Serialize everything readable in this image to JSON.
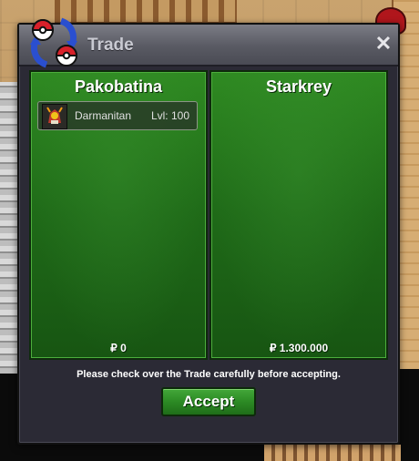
{
  "window": {
    "title": "Trade",
    "close_label": "✕"
  },
  "left_panel": {
    "player_name": "Pakobatina",
    "items": [
      {
        "pokemon": "Darmanitan",
        "level": "Lvl: 100"
      }
    ],
    "money": "₽ 0"
  },
  "right_panel": {
    "player_name": "Starkrey",
    "items": [],
    "money": "₽ 1.300.000"
  },
  "notice": "Please check over the Trade carefully before accepting.",
  "accept_label": "Accept",
  "colors": {
    "panel_green": "#1f6a18",
    "accept_green": "#2c8a24",
    "window_bg": "#2b2a35",
    "titlebar": "#595a63"
  },
  "icons": {
    "trade_logo": "pokeball-swap-icon",
    "item_sprite": "darmanitan-sprite-icon",
    "close": "close-icon"
  }
}
